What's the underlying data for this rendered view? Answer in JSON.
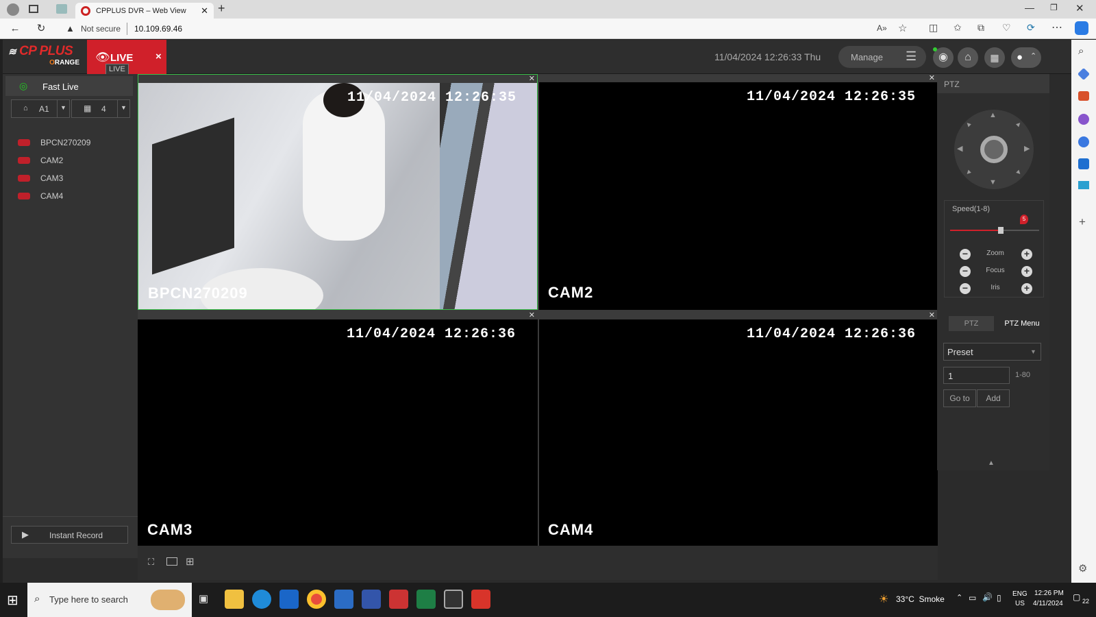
{
  "browser": {
    "tab_title": "CPPLUS DVR – Web View",
    "new_tab": "+",
    "security": "Not secure",
    "url": "10.109.69.46"
  },
  "app": {
    "logo_top": "CP PLUS",
    "logo_bottom": "RANGE",
    "logo_o": "O",
    "live_tab": "LIVE",
    "live_tooltip": "LIVE",
    "live_close": "×",
    "datetime": "11/04/2024 12:26:33 Thu",
    "manage": "Manage"
  },
  "sidebar": {
    "fast_live": "Fast Live",
    "stream": "A1",
    "split": "4",
    "channels": [
      "BPCN270209",
      "CAM2",
      "CAM3",
      "CAM4"
    ],
    "instant_record": "Instant Record"
  },
  "cells": [
    {
      "timestamp": "11/04/2024 12:26:35",
      "name": "BPCN270209"
    },
    {
      "timestamp": "11/04/2024 12:26:35",
      "name": "CAM2"
    },
    {
      "timestamp": "11/04/2024 12:26:36",
      "name": "CAM3"
    },
    {
      "timestamp": "11/04/2024 12:26:36",
      "name": "CAM4"
    }
  ],
  "ptz": {
    "title": "PTZ",
    "speed_label": "Speed(1-8)",
    "speed_value": "5",
    "speed_fraction": 0.57,
    "zoom": "Zoom",
    "focus": "Focus",
    "iris": "Iris",
    "tab_ptz": "PTZ",
    "tab_menu": "PTZ Menu",
    "preset": "Preset",
    "preset_value": "1",
    "preset_range": "1-80",
    "goto": "Go to",
    "add": "Add"
  },
  "taskbar": {
    "search_placeholder": "Type here to search",
    "weather": "33°C  Smoke",
    "lang_top": "ENG",
    "lang_bottom": "US",
    "time": "12:26 PM",
    "date": "4/11/2024",
    "notifications": "22"
  },
  "colors": {
    "brand_red": "#d0202a",
    "selected_green": "#3ac04a",
    "record_red": "#c0202a"
  }
}
